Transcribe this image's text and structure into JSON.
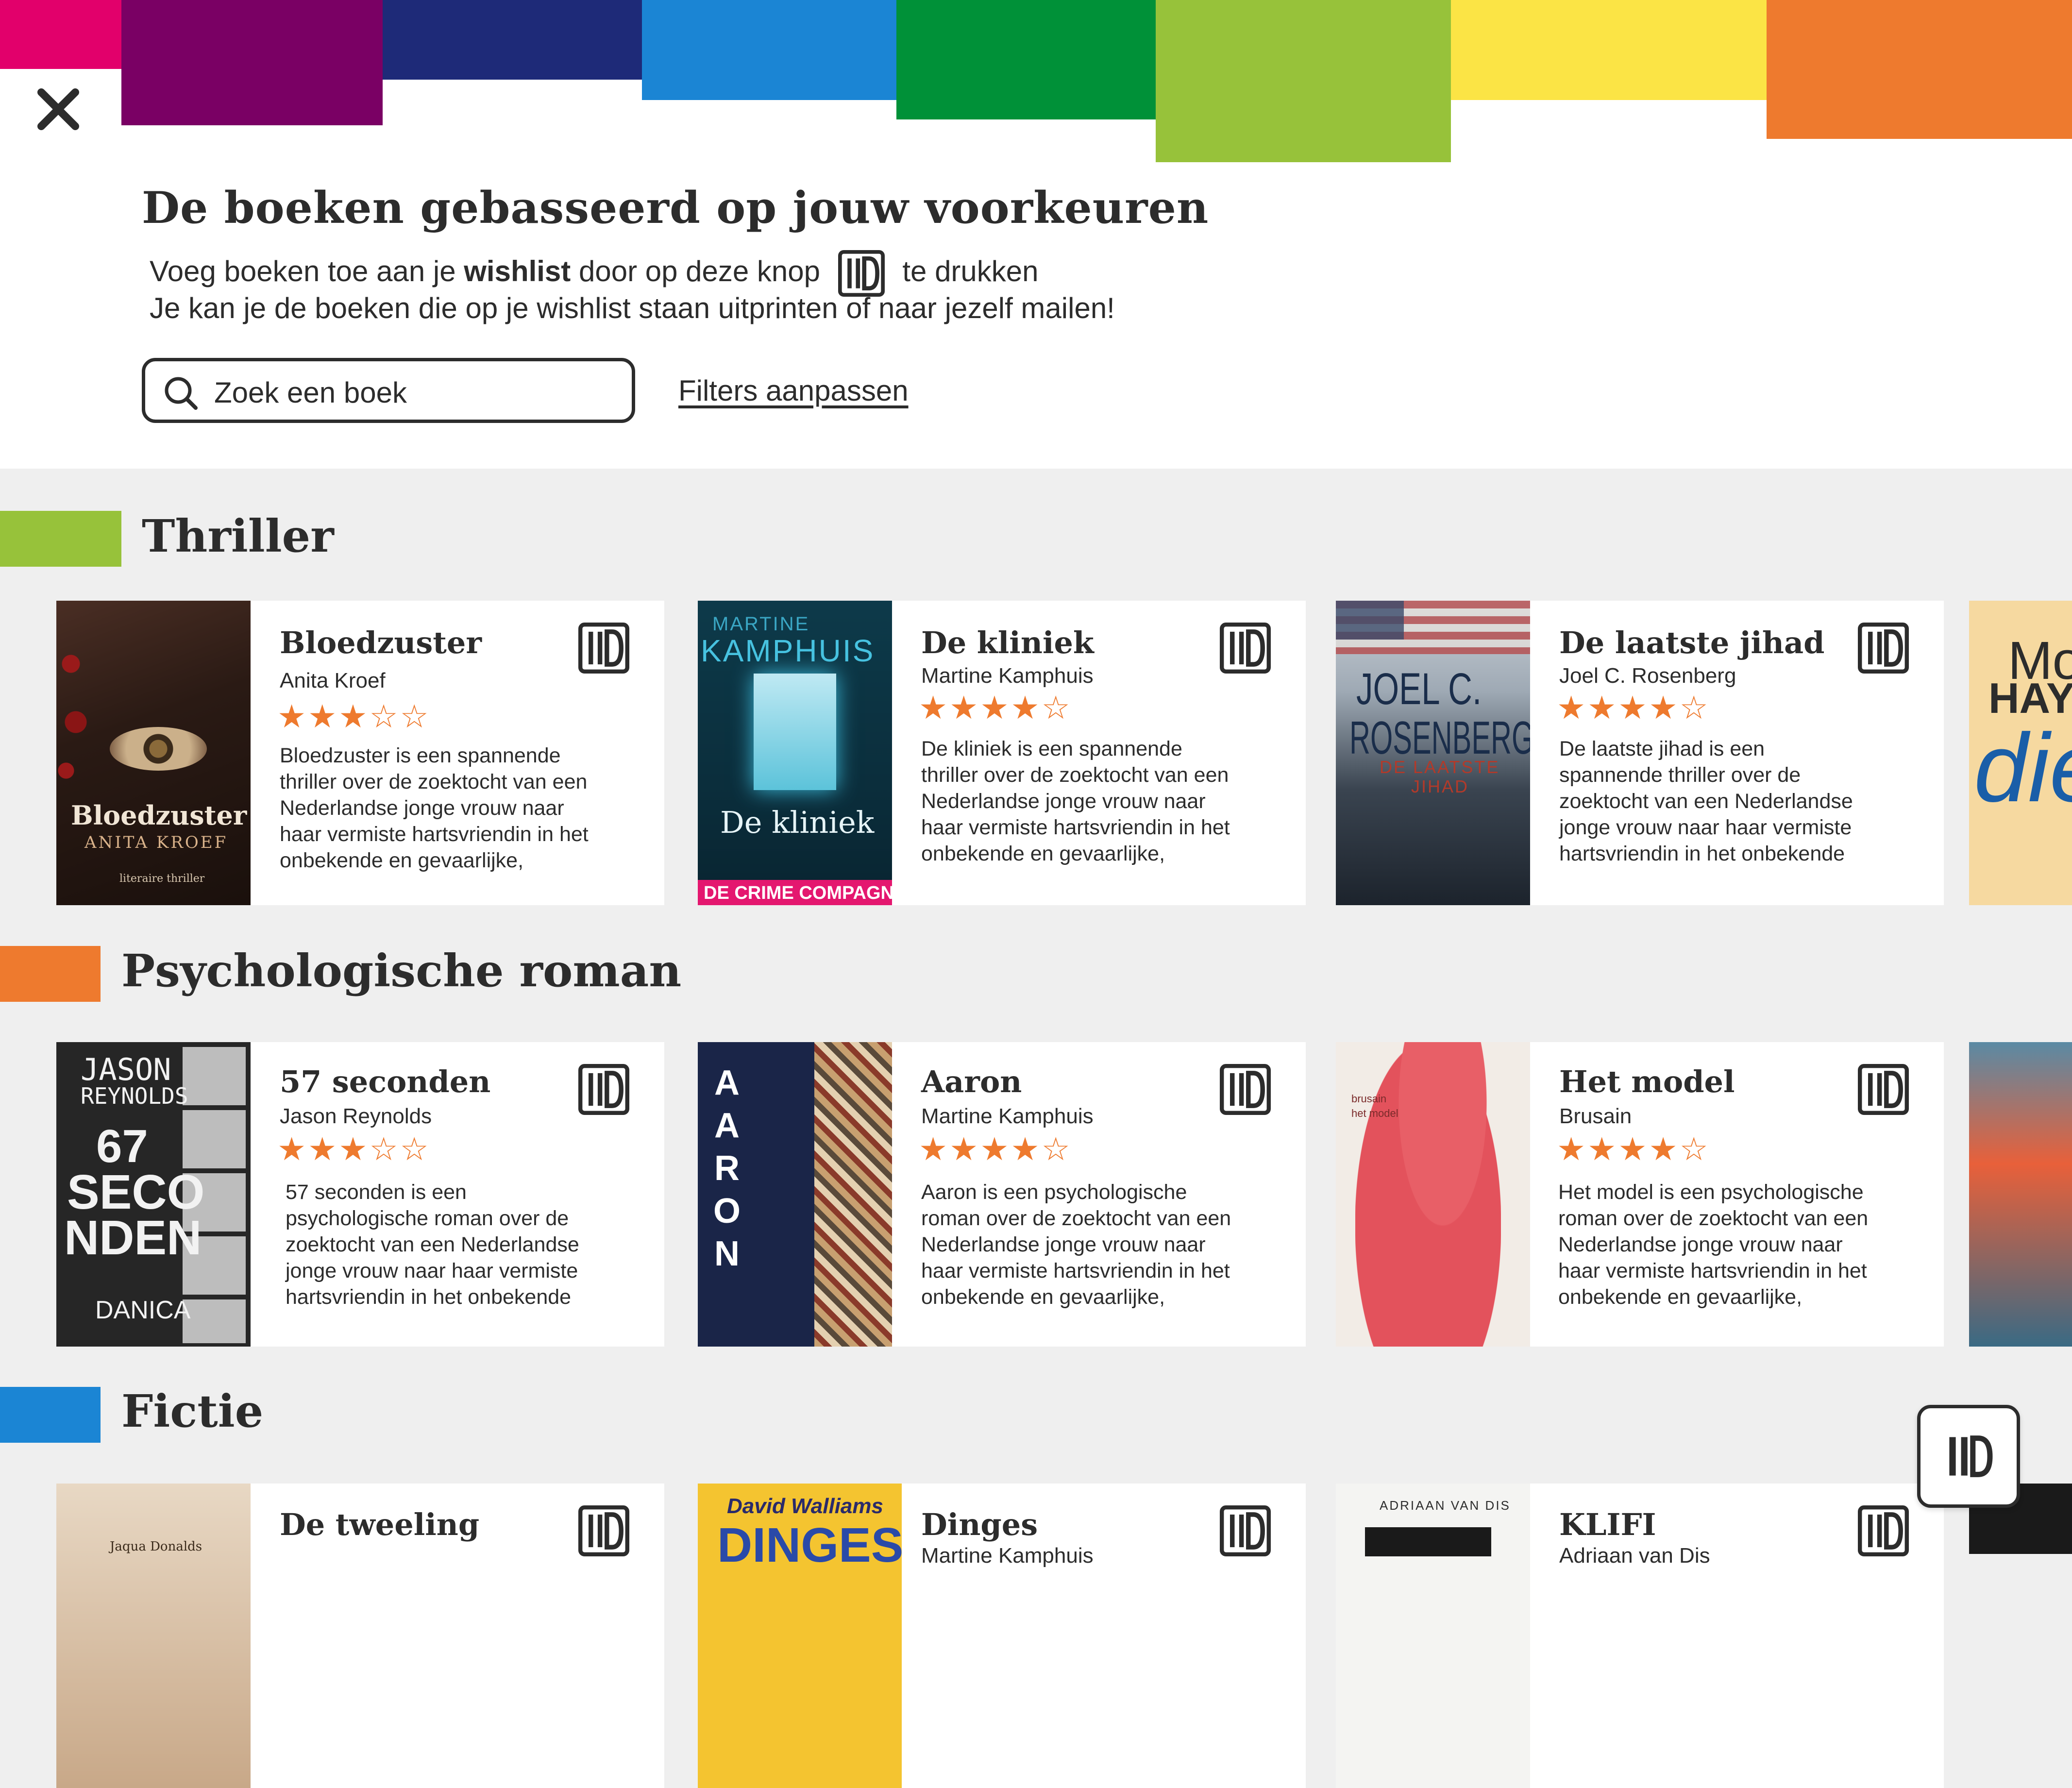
{
  "header": {
    "title": "De boeken gebasseerd op jouw voorkeuren",
    "subtitle_line1_pre": "Voeg boeken toe aan je ",
    "subtitle_line1_bold": "wishlist",
    "subtitle_line1_mid": " door op deze knop ",
    "subtitle_line1_post": " te drukken",
    "subtitle_line2": "Je kan je de boeken die op je wishlist staan uitprinten of naar jezelf mailen!",
    "search_placeholder": "Zoek een boek",
    "filters_link": "Filters aanpassen",
    "stripe_colors": [
      "#e2006b",
      "#7a0064",
      "#1e2a78",
      "#1b85d4",
      "#009138",
      "#97c23a",
      "#fbe445",
      "#ee7a2e"
    ]
  },
  "sections": [
    {
      "title": "Thriller",
      "accent": "#97c23a",
      "books": [
        {
          "title": "Bloedzuster",
          "author": "Anita Kroef",
          "rating": 3,
          "stars": "★★★☆☆",
          "description": "Bloedzuster is een spannende thriller over de zoektocht van een Nederlandse jonge vrouw naar haar vermiste hartsvriendin in het onbekende en gevaarlijke,",
          "cover": {
            "title": "Bloedzuster",
            "author": "ANITA KROEF",
            "tag": "literaire thriller"
          }
        },
        {
          "title": "De kliniek",
          "author": "Martine Kamphuis",
          "rating": 4,
          "stars": "★★★★☆",
          "description": "De kliniek is een spannende thriller over de zoektocht van een Nederlandse jonge vrouw naar haar vermiste hartsvriendin in het onbekende en gevaarlijke,",
          "cover": {
            "author_first": "MARTINE",
            "author_last": "KAMPHUIS",
            "title": "De kliniek",
            "banner": "DE CRIME COMPAGNIE"
          }
        },
        {
          "title": "De laatste jihad",
          "author": "Joel C. Rosenberg",
          "rating": 4,
          "stars": "★★★★☆",
          "description": "De laatste jihad is een spannende thriller over de zoektocht van een Nederlandse jonge vrouw naar haar vermiste hartsvriendin in het onbekende",
          "cover": {
            "author_first": "JOEL C.",
            "author_last": "ROSENBERG",
            "title1": "DE LAATSTE",
            "title2": "JIHAD"
          }
        }
      ],
      "peek": {
        "text1": "Mo",
        "text2": "HAY",
        "text3": "die"
      }
    },
    {
      "title": "Psychologische roman",
      "accent": "#ee7a2e",
      "books": [
        {
          "title": "57 seconden",
          "author": "Jason Reynolds",
          "rating": 3,
          "stars": "★★★☆☆",
          "description": "57 seconden is een psychologische roman over de zoektocht van een Nederlandse jonge vrouw naar haar vermiste hartsvriendin in het onbekende",
          "cover": {
            "author_first": "JASON",
            "author_last": "REYNOLDS",
            "t1": "67",
            "t2": "SECO",
            "t3": "NDEN",
            "illus": "DANICA"
          }
        },
        {
          "title": "Aaron",
          "author": "Martine Kamphuis",
          "rating": 4,
          "stars": "★★★★☆",
          "description": "Aaron is een psychologische roman over de zoektocht van een Nederlandse jonge vrouw naar haar vermiste hartsvriendin in het onbekende en gevaarlijke,",
          "cover": {
            "title": "AARON"
          }
        },
        {
          "title": "Het model",
          "author": "Brusain",
          "rating": 4,
          "stars": "★★★★☆",
          "description": "Het model is een psychologische roman over de zoektocht van een Nederlandse jonge vrouw naar haar vermiste hartsvriendin in het onbekende en gevaarlijke,",
          "cover": {
            "author": "brusain",
            "title": "het model"
          }
        }
      ]
    },
    {
      "title": "Fictie",
      "accent": "#1b85d4",
      "books": [
        {
          "title": "De tweeling",
          "cover": {
            "author": "Jaqua Donalds"
          }
        },
        {
          "title": "Dinges",
          "author": "Martine Kamphuis",
          "cover": {
            "author": "David Walliams",
            "title": "DINGES"
          }
        },
        {
          "title": "KLIFI",
          "author": "Adriaan van Dis",
          "cover": {
            "author": "ADRIAAN VAN DIS"
          }
        }
      ]
    }
  ],
  "icons": {
    "close": "close-icon",
    "search": "search-icon",
    "wishlist": "wishlist-icon"
  }
}
